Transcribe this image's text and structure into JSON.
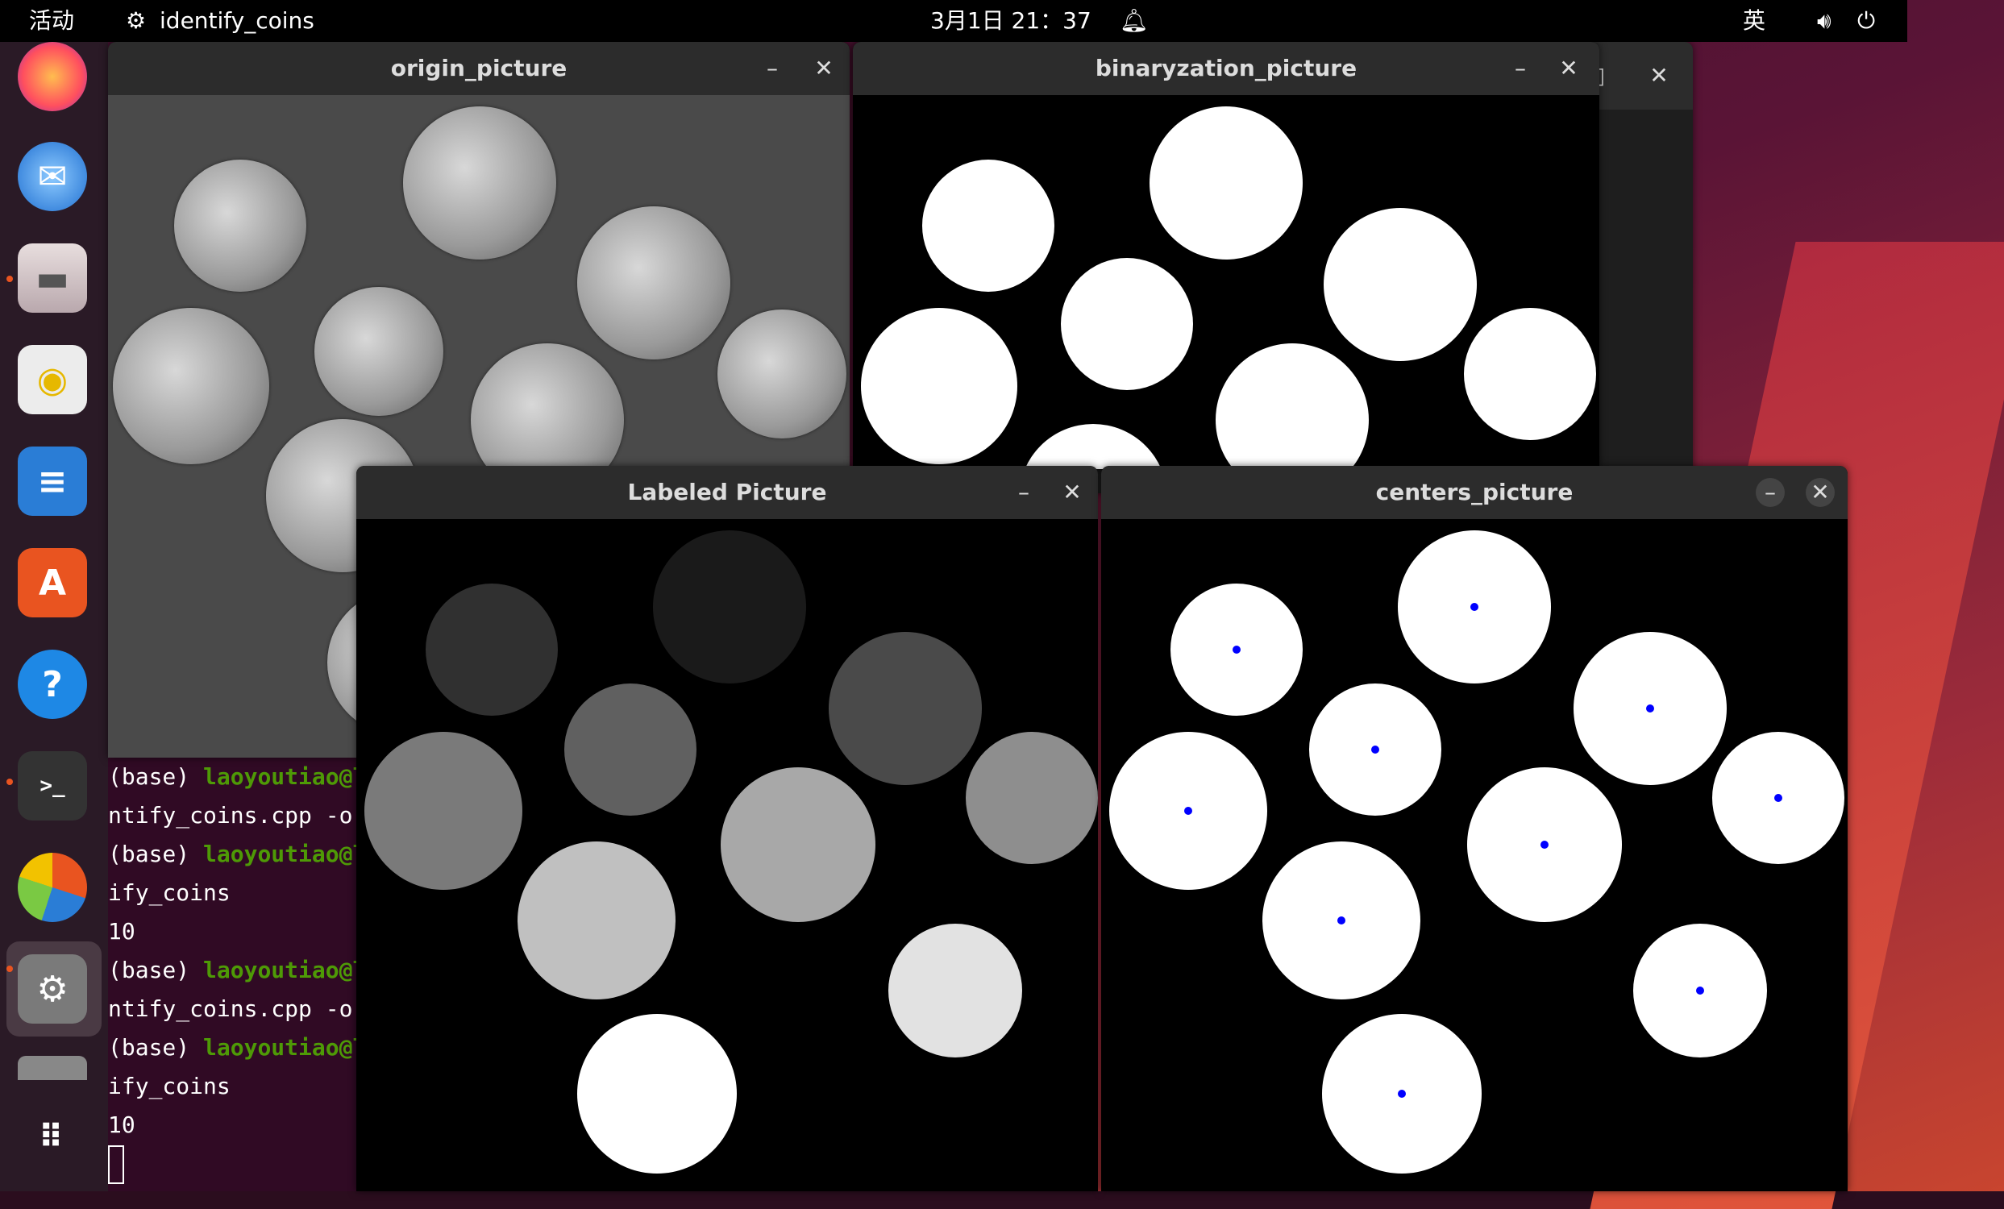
{
  "topbar": {
    "activities": "活动",
    "app_name": "identify_coins",
    "datetime": "3月1日 21：37",
    "input_method": "英"
  },
  "dock": {
    "items": [
      "firefox-icon",
      "thunderbird-icon",
      "files-icon",
      "rhythmbox-icon",
      "writer-icon",
      "app-center-icon",
      "help-icon",
      "terminal-icon",
      "chart-app-icon",
      "settings-icon",
      "drive-icon",
      "show-apps-icon"
    ]
  },
  "windows": {
    "origin": {
      "title": "origin_picture"
    },
    "binary": {
      "title": "binaryzation_picture"
    },
    "labeled": {
      "title": "Labeled Picture"
    },
    "centers": {
      "title": "centers_picture"
    }
  },
  "terminal": {
    "lines": [
      {
        "prefix": "(base) ",
        "user": "laoyoutiao@l",
        "rest": ""
      },
      {
        "prefix": "ntify_coins.cpp -o",
        "user": "",
        "rest": ""
      },
      {
        "prefix": "(base) ",
        "user": "laoyoutiao@l",
        "rest": ""
      },
      {
        "prefix": "ify_coins",
        "user": "",
        "rest": ""
      },
      {
        "prefix": "10",
        "user": "",
        "rest": ""
      },
      {
        "prefix": "(base) ",
        "user": "laoyoutiao@l",
        "rest": ""
      },
      {
        "prefix": "ntify_coins.cpp -o",
        "user": "",
        "rest": ""
      },
      {
        "prefix": "(base) ",
        "user": "laoyoutiao@l",
        "rest": ""
      },
      {
        "prefix": "ify_coins",
        "user": "",
        "rest": ""
      },
      {
        "prefix": "10",
        "user": "",
        "rest": ""
      }
    ]
  },
  "labeled_gray_levels": [
    "#303030",
    "#1a1a1a",
    "#4a4a4a",
    "#606060",
    "#7a7a7a",
    "#8e8e8e",
    "#a8a8a8",
    "#c0c0c0",
    "#e2e2e2",
    "#ffffff"
  ],
  "colors": {
    "terminal_bg": "#300a24",
    "center_dot": "#0000ff",
    "prompt_green": "#4e9a06"
  }
}
